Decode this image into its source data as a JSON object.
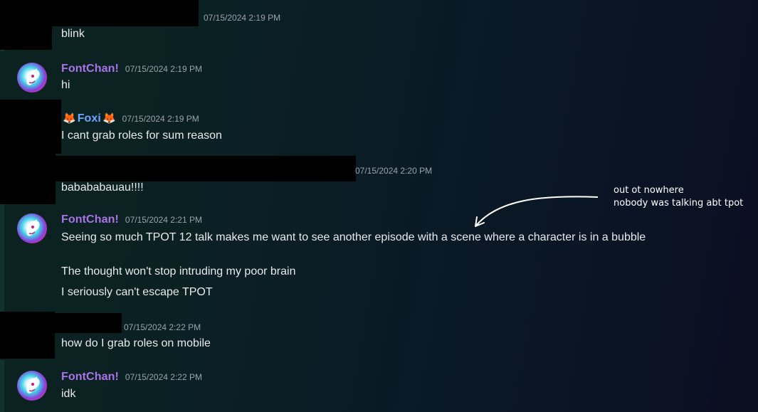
{
  "messages": {
    "m1": {
      "timestamp": "07/15/2024 2:19 PM",
      "text": "blink"
    },
    "m2": {
      "author": "FontChan!",
      "timestamp": "07/15/2024 2:19 PM",
      "text": "hi"
    },
    "m3": {
      "author": "Foxi",
      "author_prefix": "🦊",
      "author_suffix": "🦊",
      "timestamp": "07/15/2024 2:19 PM",
      "text": "I cant grab roles for sum reason"
    },
    "m4": {
      "timestamp": "07/15/2024 2:20 PM",
      "text": "babababauau!!!!"
    },
    "m5": {
      "author": "FontChan!",
      "timestamp": "07/15/2024 2:21 PM",
      "text": "Seeing so much TPOT 12 talk makes me want to see another episode with a scene where a character is in a bubble",
      "followups": [
        "The thought won't stop intruding my poor brain",
        "I seriously can't escape TPOT"
      ]
    },
    "m6": {
      "timestamp": "07/15/2024 2:22 PM",
      "text": "how do I grab roles on mobile"
    },
    "m7": {
      "author": "FontChan!",
      "timestamp": "07/15/2024 2:22 PM",
      "text": "idk"
    }
  },
  "annotation": {
    "line1": "out ot nowhere",
    "line2": "nobody was talking abt tpot"
  },
  "colors": {
    "fontchan_name": "#a874e8",
    "foxi_name": "#6aa6ff",
    "timestamp": "#9aa3ad",
    "redaction": "#000000"
  },
  "icons": {
    "avatar": "fontchan-avatar",
    "arrow": "curved-arrow-icon"
  }
}
